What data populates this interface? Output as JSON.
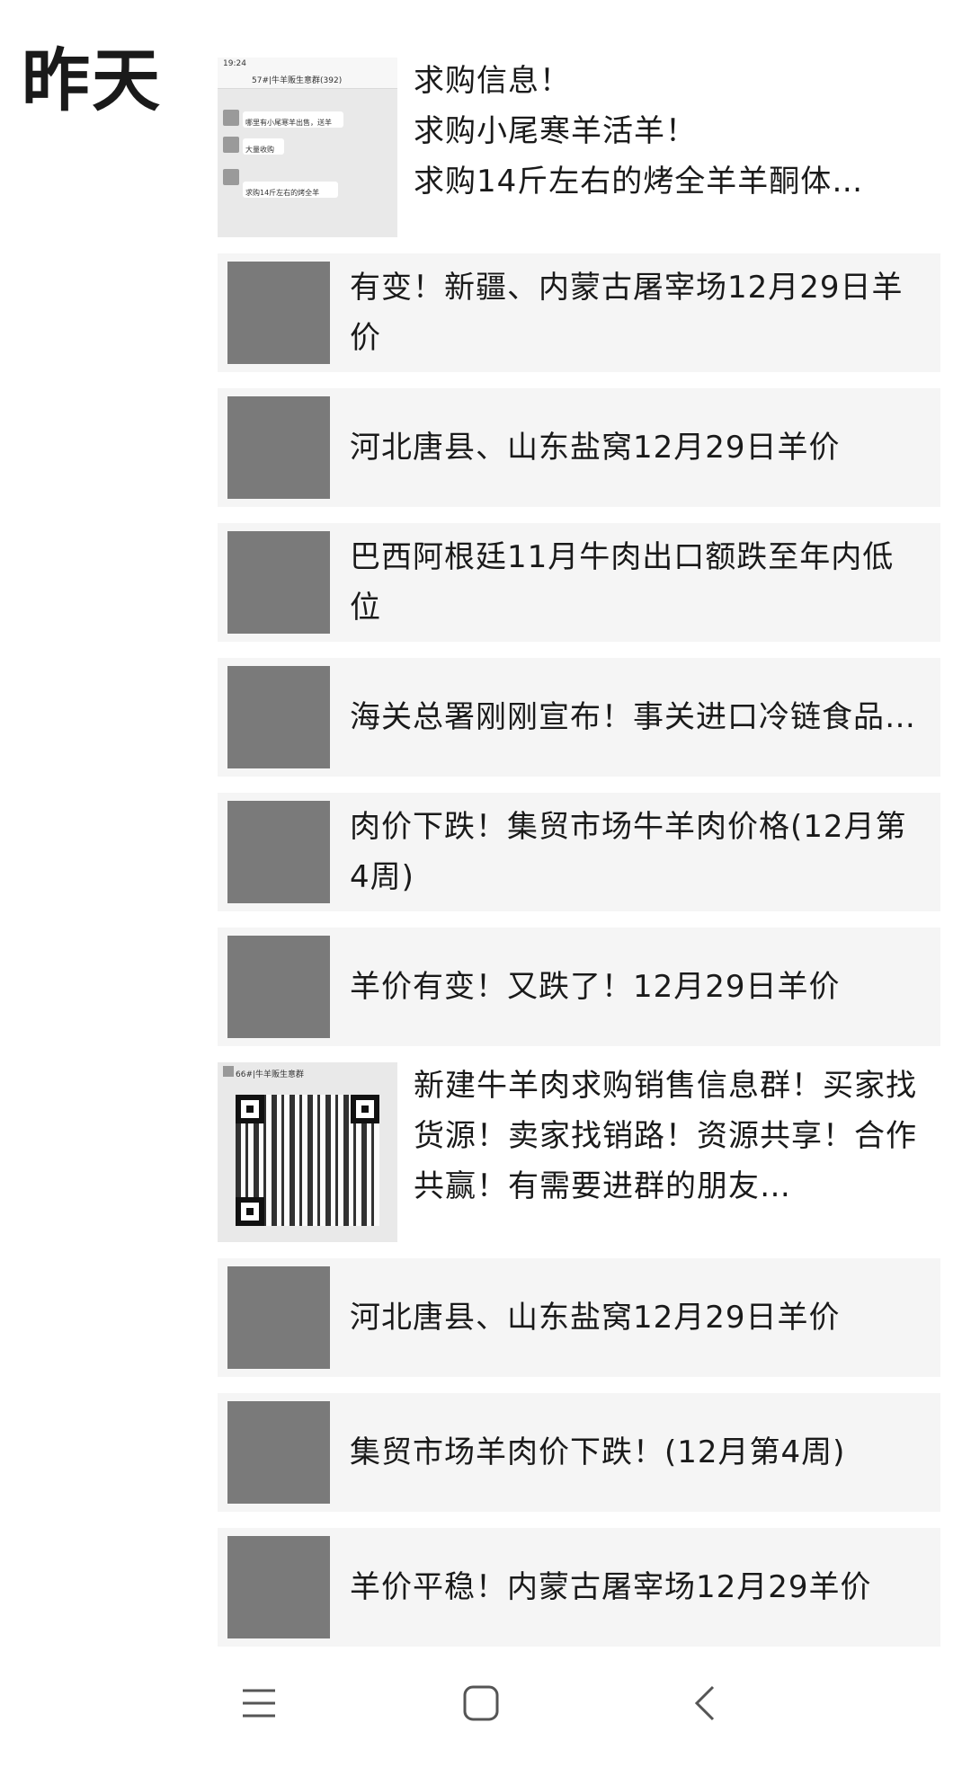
{
  "header": {
    "date_label": "昨天"
  },
  "feed": {
    "post_top": {
      "text": "求购信息！\n求购小尾寒羊活羊！\n求购14斤左右的烤全羊羊酮体…",
      "thumbnail_icon": "chat-screenshot-image",
      "thumbnail_text": {
        "status_time": "19:24",
        "group_title": "57#|牛羊贩生意群(392)",
        "msg1": "哪里有小尾寒羊出售，送羊",
        "msg2": "大量收购",
        "msg3": "求购14斤左右的烤全羊"
      }
    },
    "cards_a": [
      {
        "title": "有变！新疆、内蒙古屠宰场12月29日羊价",
        "thumbnail_icon": "slaughterhouse-image"
      },
      {
        "title": "河北唐县、山东盐窝12月29日羊价",
        "thumbnail_icon": "sheep-image"
      },
      {
        "title": "巴西阿根廷11月牛肉出口额跌至年内低位",
        "thumbnail_icon": "beef-steak-image"
      },
      {
        "title": "海关总署刚刚宣布！事关进口冷链食品…",
        "thumbnail_icon": "customs-emblem-image"
      },
      {
        "title": "肉价下跌！集贸市场牛羊肉价格(12月第4周)",
        "thumbnail_icon": "raw-meat-image"
      },
      {
        "title": "羊价有变！又跌了！12月29日羊价",
        "thumbnail_icon": "slaughter-hall-image"
      }
    ],
    "post_qr": {
      "text": "新建牛羊肉求购销售信息群！买家找货源！卖家找销路！资源共享！合作共赢！有需要进群的朋友…",
      "thumbnail_icon": "qr-code-image",
      "thumbnail_caption": "66#|牛羊贩生意群"
    },
    "cards_b": [
      {
        "title": "河北唐县、山东盐窝12月29日羊价",
        "thumbnail_icon": "sheep-image"
      },
      {
        "title": "集贸市场羊肉价下跌！(12月第4周)",
        "thumbnail_icon": "meat-market-image"
      },
      {
        "title": "羊价平稳！内蒙古屠宰场12月29羊价",
        "thumbnail_icon": "slaughter-hall-image"
      }
    ]
  },
  "navbar": {
    "menu_icon": "menu-icon",
    "home_icon": "home-icon",
    "back_icon": "back-icon"
  }
}
